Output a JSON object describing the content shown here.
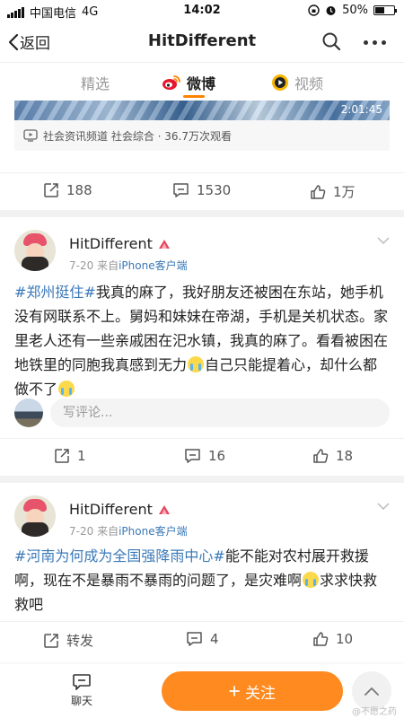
{
  "status_bar": {
    "carrier": "中国电信",
    "network": "4G",
    "time": "14:02",
    "battery": "50%",
    "battery_level": 0.5
  },
  "nav": {
    "back_label": "返回",
    "title": "HitDifferent",
    "icons": [
      "back-chevron-icon",
      "search-icon",
      "more-icon"
    ]
  },
  "tabs": [
    {
      "label": "精选",
      "active": false
    },
    {
      "label": "微博",
      "active": true,
      "icon": "weibo-icon"
    },
    {
      "label": "视频",
      "active": false,
      "icon": "video-icon"
    }
  ],
  "video_post": {
    "duration": "2:01:45",
    "source_text": "社会资讯频道 社会综合 · 36.7万次观看",
    "actions": {
      "repost": "188",
      "comment": "1530",
      "like": "1万"
    }
  },
  "posts": [
    {
      "user": "HitDifferent",
      "date": "7-20",
      "source_prefix": "来自",
      "source": "iPhone客户端",
      "text": {
        "hashtag": "#郑州挺住#",
        "body1": "我真的麻了，我好朋友还被困在东站，她手机没有网联系不上。舅妈和妹妹在帝湖，手机是关机状态。家里老人还有一些亲戚困在汜水镇，我真的麻了。看看被困在地铁里的同胞我真感到无力",
        "body2": "自己只能提着心，却什么都做不了"
      },
      "comment_placeholder": "写评论...",
      "actions": {
        "repost": "1",
        "comment": "16",
        "like": "18"
      }
    },
    {
      "user": "HitDifferent",
      "date": "7-20",
      "source_prefix": "来自",
      "source": "iPhone客户端",
      "text": {
        "hashtag": "#河南为何成为全国强降雨中心#",
        "body1": "能不能对农村展开救援啊，现在不是暴雨不暴雨的问题了，是灾难啊",
        "body2": "求求快救救吧"
      },
      "actions": {
        "repost": "转发",
        "comment": "4",
        "like": "10"
      }
    }
  ],
  "bottom_bar": {
    "chat_label": "聊天",
    "follow_label": "关注",
    "watermark": "@不愿之药"
  },
  "colors": {
    "accent": "#ff8200",
    "link": "#3b79b8",
    "vip_badge": "#e8455e"
  }
}
